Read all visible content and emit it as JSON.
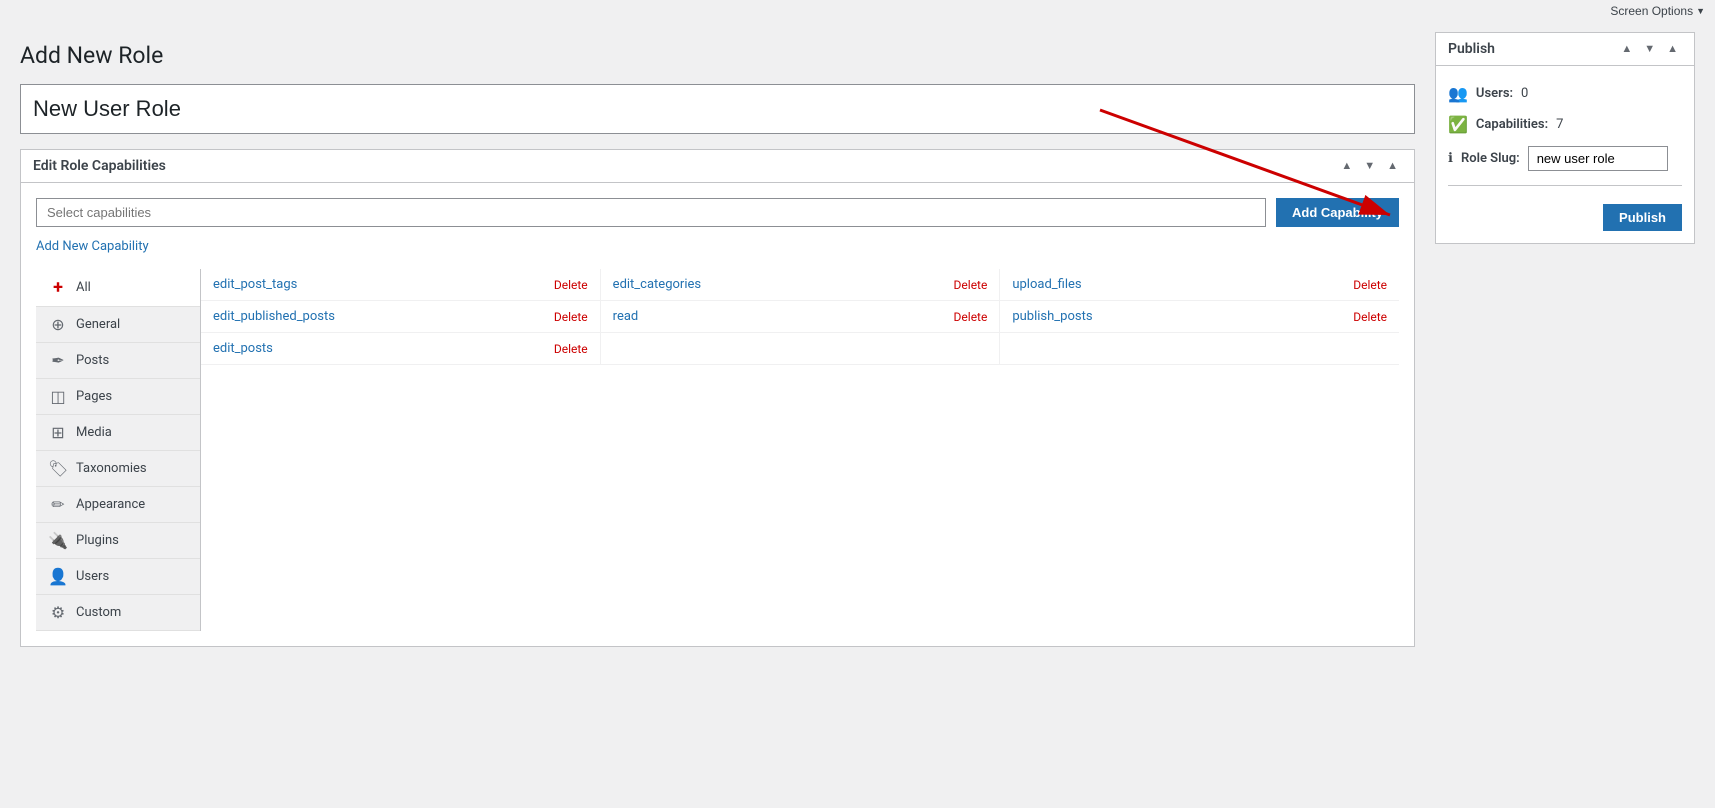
{
  "topBar": {
    "screenOptions": "Screen Options"
  },
  "pageTitle": "Add New Role",
  "roleNameInput": {
    "value": "New User Role",
    "placeholder": "New User Role"
  },
  "capabilitiesPanel": {
    "title": "Edit Role Capabilities",
    "selectPlaceholder": "Select capabilities",
    "addCapabilityBtn": "Add Capability",
    "addNewCapabilityLink": "Add New Capability"
  },
  "categories": [
    {
      "id": "all",
      "icon": "+",
      "label": "All",
      "active": true
    },
    {
      "id": "general",
      "icon": "⊕",
      "label": "General"
    },
    {
      "id": "posts",
      "icon": "✏",
      "label": "Posts"
    },
    {
      "id": "pages",
      "icon": "▣",
      "label": "Pages"
    },
    {
      "id": "media",
      "icon": "⊞",
      "label": "Media"
    },
    {
      "id": "taxonomies",
      "icon": "🏷",
      "label": "Taxonomies"
    },
    {
      "id": "appearance",
      "icon": "✏",
      "label": "Appearance"
    },
    {
      "id": "plugins",
      "icon": "✏",
      "label": "Plugins"
    },
    {
      "id": "users",
      "icon": "👤",
      "label": "Users"
    },
    {
      "id": "custom",
      "icon": "⚙",
      "label": "Custom"
    }
  ],
  "capabilitiesRows": [
    {
      "col1": {
        "name": "edit_post_tags",
        "delete": "Delete"
      },
      "col2": {
        "name": "edit_categories",
        "delete": "Delete"
      },
      "col3": {
        "name": "upload_files",
        "delete": "Delete"
      }
    },
    {
      "col1": {
        "name": "edit_published_posts",
        "delete": "Delete"
      },
      "col2": {
        "name": "read",
        "delete": "Delete"
      },
      "col3": {
        "name": "publish_posts",
        "delete": "Delete"
      }
    },
    {
      "col1": {
        "name": "edit_posts",
        "delete": "Delete"
      },
      "col2": null,
      "col3": null
    }
  ],
  "publishBox": {
    "title": "Publish",
    "usersLabel": "Users:",
    "usersCount": "0",
    "capabilitiesLabel": "Capabilities:",
    "capabilitiesCount": "7",
    "roleSlugLabel": "Role Slug:",
    "roleSlugValue": "new user role",
    "publishBtn": "Publish"
  }
}
